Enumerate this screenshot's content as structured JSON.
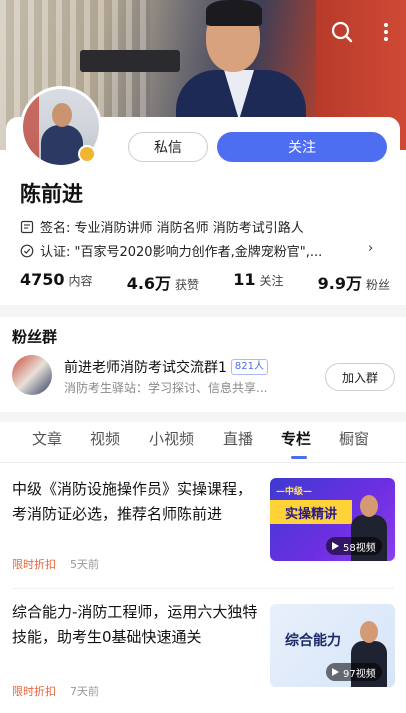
{
  "header": {
    "search_icon": "search-icon",
    "more_icon": "more-icon"
  },
  "profile": {
    "name": "陈前进",
    "message_label": "私信",
    "follow_label": "关注",
    "signature": "签名: 专业消防讲师 消防名师 消防考试引路人",
    "certification": "认证: \"百家号2020影响力创作者,金牌宠粉官\",...",
    "stats": [
      {
        "value": "4750",
        "label": "内容"
      },
      {
        "value": "4.6万",
        "label": "获赞"
      },
      {
        "value": "11",
        "label": "关注"
      },
      {
        "value": "9.9万",
        "label": "粉丝"
      }
    ]
  },
  "fans": {
    "title": "粉丝群",
    "group_name": "前进老师消防考试交流群1",
    "group_count": "821人",
    "group_desc": "消防考生驿站：学习探讨、信息共享...",
    "join_label": "加入群"
  },
  "tabs": {
    "items": [
      "文章",
      "视频",
      "小视频",
      "直播",
      "专栏",
      "橱窗"
    ],
    "active": "专栏"
  },
  "articles": [
    {
      "title": "中级《消防设施操作员》实操课程，考消防证必选，推荐名师陈前进",
      "tag": "限时折扣",
      "time": "5天前",
      "thumb_top": "—中级—",
      "thumb_banner": "实操精讲",
      "video_count": "58视频"
    },
    {
      "title": "综合能力-消防工程师，运用六大独特技能，助考生0基础快速通关",
      "tag": "限时折扣",
      "time": "7天前",
      "thumb_banner": "综合能力",
      "video_count": "97视频"
    }
  ],
  "colors": {
    "accent": "#4e6ef2",
    "tag": "#e8643b",
    "verify": "#f1b631"
  }
}
